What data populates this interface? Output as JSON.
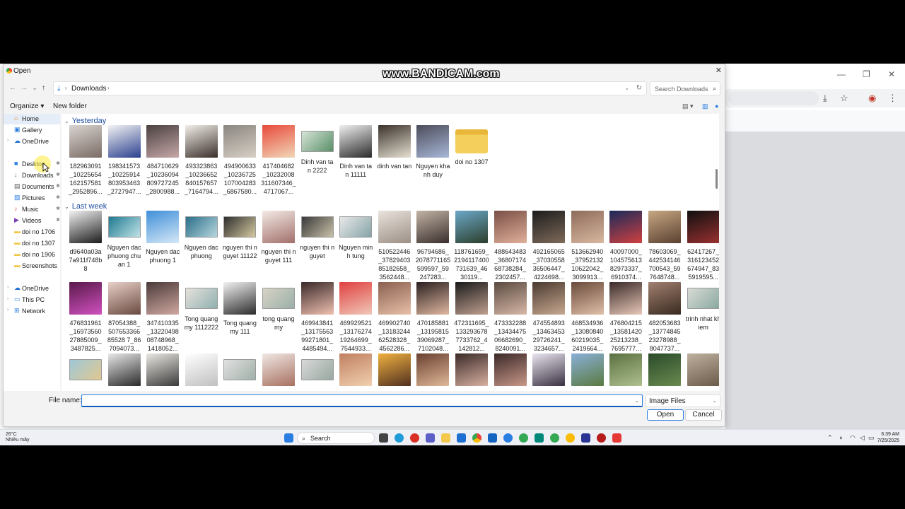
{
  "watermark": "www.BANDICAM.com",
  "dialog": {
    "title": "Open",
    "close_glyph": "✕"
  },
  "nav": {
    "back": "←",
    "forward": "→",
    "recent": "⌄",
    "up": "↑",
    "path_icon": "download-icon",
    "crumb": "Downloads",
    "search_placeholder": "Search Downloads"
  },
  "commands": {
    "organize": "Organize ▾",
    "new_folder": "New folder"
  },
  "navpane": [
    {
      "label": "Home",
      "icon": "home-icon",
      "glyph": "⌂",
      "color": "#e67e22",
      "chev": "",
      "pin": "",
      "sel": true
    },
    {
      "label": "Gallery",
      "icon": "gallery-icon",
      "glyph": "▣",
      "color": "#2a7de1",
      "chev": "",
      "pin": ""
    },
    {
      "label": "OneDrive",
      "icon": "onedrive-icon",
      "glyph": "☁",
      "color": "#1e6fd1",
      "chev": "›",
      "pin": ""
    },
    {
      "label": "Desktop",
      "icon": "desktop-icon",
      "glyph": "■",
      "color": "#2a7de1",
      "chev": "",
      "pin": "✱"
    },
    {
      "label": "Downloads",
      "icon": "downloads-icon",
      "glyph": "↓",
      "color": "#2e8b57",
      "chev": "",
      "pin": "✱"
    },
    {
      "label": "Documents",
      "icon": "documents-icon",
      "glyph": "▤",
      "color": "#555",
      "chev": "",
      "pin": "✱"
    },
    {
      "label": "Pictures",
      "icon": "pictures-icon",
      "glyph": "▨",
      "color": "#2a7de1",
      "chev": "",
      "pin": "✱"
    },
    {
      "label": "Music",
      "icon": "music-icon",
      "glyph": "♪",
      "color": "#e0533c",
      "chev": "",
      "pin": "✱"
    },
    {
      "label": "Videos",
      "icon": "videos-icon",
      "glyph": "▶",
      "color": "#7b3fb5",
      "chev": "",
      "pin": "✱"
    },
    {
      "label": "doi no 1706",
      "icon": "folder-icon",
      "glyph": "▬",
      "color": "#f2c94c",
      "chev": "",
      "pin": ""
    },
    {
      "label": "doi no 1307",
      "icon": "folder-icon",
      "glyph": "▬",
      "color": "#f2c94c",
      "chev": "",
      "pin": ""
    },
    {
      "label": "doi no 1906",
      "icon": "folder-icon",
      "glyph": "▬",
      "color": "#f2c94c",
      "chev": "",
      "pin": ""
    },
    {
      "label": "Screenshots",
      "icon": "folder-icon",
      "glyph": "▬",
      "color": "#f2c94c",
      "chev": "",
      "pin": ""
    },
    {
      "label": "OneDrive",
      "icon": "onedrive-icon",
      "glyph": "☁",
      "color": "#1e6fd1",
      "chev": "›",
      "pin": ""
    },
    {
      "label": "This PC",
      "icon": "this-pc-icon",
      "glyph": "▭",
      "color": "#2a7de1",
      "chev": "›",
      "pin": ""
    },
    {
      "label": "Network",
      "icon": "network-icon",
      "glyph": "⊞",
      "color": "#2a7de1",
      "chev": "›",
      "pin": ""
    }
  ],
  "groups": [
    {
      "label": "Yesterday",
      "rows": [
        [
          {
            "name": "182963091_10225654162157581_2952896...",
            "kind": "photo",
            "c": [
              "#d9d4d0",
              "#7a6b65"
            ]
          },
          {
            "name": "198341573_10225914803953463_2727947...",
            "kind": "photo",
            "c": [
              "#f4f4f4",
              "#2a3f8e"
            ]
          },
          {
            "name": "484710629_10236094809727245_2800988...",
            "kind": "photo",
            "c": [
              "#4a4040",
              "#c7a8a8"
            ]
          },
          {
            "name": "493323863_10236652840157657_7164794...",
            "kind": "photo",
            "c": [
              "#f3efe9",
              "#3a2f2a"
            ]
          },
          {
            "name": "494900633_10236725107004283_6867580...",
            "kind": "photo",
            "c": [
              "#8a8580",
              "#d8d0c5"
            ]
          },
          {
            "name": "417404682_10232008311607346_4717067...",
            "kind": "photo",
            "c": [
              "#e84a3b",
              "#f1d7b8"
            ]
          },
          {
            "name": "Dinh van tan 2222",
            "kind": "card",
            "c": [
              "#d6e4d8",
              "#5a8f68"
            ]
          },
          {
            "name": "Dinh van tan 11111",
            "kind": "photo",
            "c": [
              "#f0f0f0",
              "#2a2a2a"
            ]
          },
          {
            "name": "dinh van tan",
            "kind": "photo",
            "c": [
              "#3b332c",
              "#e6e0d2"
            ]
          },
          {
            "name": "Nguyen khanh duy",
            "kind": "photo",
            "c": [
              "#4c4c5a",
              "#a8b8d8"
            ]
          },
          {
            "name": "doi no 1307",
            "kind": "folder",
            "c": [
              "#f5cf5b",
              "#e8b638"
            ]
          }
        ]
      ]
    },
    {
      "label": "Last week",
      "rows": [
        [
          {
            "name": "d9640a03a7a911f748b8",
            "kind": "photo",
            "c": [
              "#f2f2f2",
              "#1c1c1c"
            ]
          },
          {
            "name": "Nguyen dac phuong chuan 1",
            "kind": "card",
            "c": [
              "#1f7a92",
              "#bfe2e6"
            ]
          },
          {
            "name": "Nguyen dac phuong 1",
            "kind": "photo",
            "c": [
              "#3f8fd8",
              "#d6e8f7"
            ]
          },
          {
            "name": "Nguyen dac phuong",
            "kind": "card",
            "c": [
              "#2a6f88",
              "#b7d6de"
            ]
          },
          {
            "name": "nguyen thi nguyet 11122",
            "kind": "card",
            "c": [
              "#2e2e2e",
              "#d5c9a0"
            ]
          },
          {
            "name": "nguyen thi nguyet 111",
            "kind": "photo",
            "c": [
              "#f3eae5",
              "#a26f6a"
            ]
          },
          {
            "name": "nguyen thi nguyet",
            "kind": "card",
            "c": [
              "#3a3a3a",
              "#c8c0a8"
            ]
          },
          {
            "name": "Nguyen minh tung",
            "kind": "card",
            "c": [
              "#e8e8e8",
              "#86a4a8"
            ]
          },
          {
            "name": "510522446_3782940385182658_3562448...",
            "kind": "photo",
            "c": [
              "#e9e3dc",
              "#9c8f86"
            ]
          },
          {
            "name": "96794686_2078771165599597_59247283...",
            "kind": "photo",
            "c": [
              "#c2b3a3",
              "#3a2f2e"
            ]
          },
          {
            "name": "118761659_2194117400731639_4630119...",
            "kind": "photo",
            "c": [
              "#6ba8c8",
              "#2c3e2c"
            ]
          },
          {
            "name": "488643483_3680717468738284_2302457...",
            "kind": "photo",
            "c": [
              "#7a4f45",
              "#e0b09a"
            ]
          },
          {
            "name": "492165065_3703055836506447_4224698...",
            "kind": "photo",
            "c": [
              "#1c1c1c",
              "#7e6a5a"
            ]
          },
          {
            "name": "513662940_3795213210622042_3099913...",
            "kind": "photo",
            "c": [
              "#8e6b5a",
              "#d8b8a0"
            ]
          },
          {
            "name": "40097000_10457561382973337_6910374...",
            "kind": "photo",
            "c": [
              "#1a2a5a",
              "#d04040"
            ]
          },
          {
            "name": "78603069_442534146700543_597648748...",
            "kind": "photo",
            "c": [
              "#c7a883",
              "#5a4030"
            ]
          },
          {
            "name": "62417267_316123452674947_835919595...",
            "kind": "photo",
            "c": [
              "#101010",
              "#9a3030"
            ]
          }
        ],
        [
          {
            "name": "476831961_1697356027885009_3487825...",
            "kind": "photo",
            "c": [
              "#5a1a4a",
              "#d050c0"
            ]
          },
          {
            "name": "87054388_50765336685528 7_867094073...",
            "kind": "photo",
            "c": [
              "#e8d0c8",
              "#6a4a40"
            ]
          },
          {
            "name": "347410335_1322049808748968_1418052...",
            "kind": "photo",
            "c": [
              "#4a3a3a",
              "#d0a8a0"
            ]
          },
          {
            "name": "Tong quang my 1112222",
            "kind": "card",
            "c": [
              "#e6e2dc",
              "#8fb0b0"
            ]
          },
          {
            "name": "Tong quang my 111",
            "kind": "photo",
            "c": [
              "#f2f2f2",
              "#2b2b2b"
            ]
          },
          {
            "name": "tong quang my",
            "kind": "card",
            "c": [
              "#d8d2c6",
              "#9ab0a8"
            ]
          },
          {
            "name": "469943841_1317556399271801_4485494...",
            "kind": "photo",
            "c": [
              "#3a2a2a",
              "#f0c0b0"
            ]
          },
          {
            "name": "469929521_1317627419264699_7544933...",
            "kind": "photo",
            "c": [
              "#e04040",
              "#f0c8b8"
            ]
          },
          {
            "name": "469902740_1318324462528328_4562286...",
            "kind": "photo",
            "c": [
              "#8a6050",
              "#e8c0a8"
            ]
          },
          {
            "name": "470185881_1319581539069287_7102048...",
            "kind": "photo",
            "c": [
              "#2a2020",
              "#e0b8a0"
            ]
          },
          {
            "name": "472311695_1332936787733762_4142812...",
            "kind": "photo",
            "c": [
              "#1a1a1a",
              "#c0a090"
            ]
          },
          {
            "name": "473332288_1343447506682690_8240091...",
            "kind": "photo",
            "c": [
              "#5a4a40",
              "#d8b8a8"
            ]
          },
          {
            "name": "474554893_1346345329726241_3234657...",
            "kind": "photo",
            "c": [
              "#4a3a30",
              "#c8a890"
            ]
          },
          {
            "name": "468534936_1308084060219035_2419664...",
            "kind": "photo",
            "c": [
              "#6a4a3a",
              "#e0c0a8"
            ]
          },
          {
            "name": "476804215_1358142025213238_7695777...",
            "kind": "photo",
            "c": [
              "#3a2a28",
              "#e8c8b8"
            ]
          },
          {
            "name": "482053683_1377484523278988_8047737...",
            "kind": "photo",
            "c": [
              "#a08070",
              "#3a2a20"
            ]
          },
          {
            "name": "trinh nhat khiem",
            "kind": "card",
            "c": [
              "#d8dcd6",
              "#8aa8a0"
            ]
          }
        ],
        [
          {
            "name": "",
            "kind": "card",
            "c": [
              "#9fc7d8",
              "#e0c890"
            ]
          },
          {
            "name": "",
            "kind": "photo",
            "c": [
              "#e8e8e8",
              "#2a2a2a"
            ]
          },
          {
            "name": "",
            "kind": "photo",
            "c": [
              "#ebe8e2",
              "#3a3a3a"
            ]
          },
          {
            "name": "",
            "kind": "photo",
            "c": [
              "#ffffff",
              "#c0c0c0"
            ]
          },
          {
            "name": "",
            "kind": "card",
            "c": [
              "#e0e0e0",
              "#a0b0a8"
            ]
          },
          {
            "name": "",
            "kind": "photo",
            "c": [
              "#f0e8e4",
              "#a87060"
            ]
          },
          {
            "name": "",
            "kind": "card",
            "c": [
              "#d8d8d8",
              "#98a8a0"
            ]
          },
          {
            "name": "",
            "kind": "photo",
            "c": [
              "#c08060",
              "#f0d0b0"
            ]
          },
          {
            "name": "",
            "kind": "photo",
            "c": [
              "#f0b040",
              "#503020"
            ]
          },
          {
            "name": "",
            "kind": "photo",
            "c": [
              "#6a4030",
              "#e0b898"
            ]
          },
          {
            "name": "",
            "kind": "photo",
            "c": [
              "#3a2a28",
              "#d8b0a0"
            ]
          },
          {
            "name": "",
            "kind": "photo",
            "c": [
              "#3a2828",
              "#c89888"
            ]
          },
          {
            "name": "",
            "kind": "photo",
            "c": [
              "#eae6f0",
              "#3a3040"
            ]
          },
          {
            "name": "",
            "kind": "photo",
            "c": [
              "#8ab0d8",
              "#5a7a40"
            ]
          },
          {
            "name": "",
            "kind": "photo",
            "c": [
              "#5a7040",
              "#b0c090"
            ]
          },
          {
            "name": "",
            "kind": "photo",
            "c": [
              "#2a4a2a",
              "#6a8a50"
            ]
          },
          {
            "name": "",
            "kind": "photo",
            "c": [
              "#c0b0a0",
              "#6a5a4a"
            ]
          }
        ]
      ]
    }
  ],
  "bottom": {
    "file_name_label": "File name:",
    "file_name_value": "",
    "filter": "Image Files",
    "open": "Open",
    "cancel": "Cancel"
  },
  "taskbar": {
    "temp": "26°C",
    "weather": "Nhiều mây",
    "search": "Search",
    "time": "6:39 AM",
    "date": "7/25/2025"
  },
  "browser": {
    "minimize": "—",
    "maximize": "❐",
    "close": "✕"
  },
  "colors": {
    "accent": "#2a7de1",
    "group_heading": "#1f4e9e",
    "selection": "#e5eef8"
  }
}
